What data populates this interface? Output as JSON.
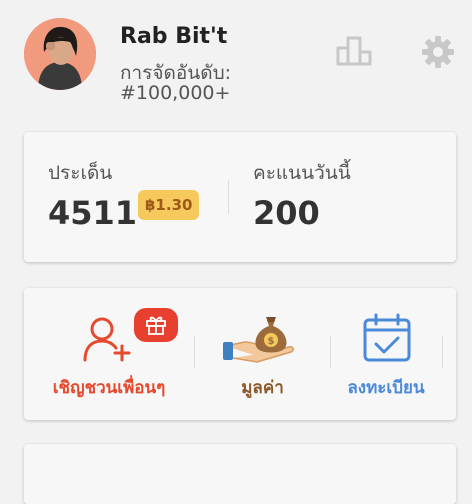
{
  "profile": {
    "name": "Rab Bit't",
    "rank_label": "การจัดอันดับ:",
    "rank_value": "#100,000+"
  },
  "points": {
    "points_label": "ประเด็น",
    "points_value": "4511",
    "baht_badge": "฿1.30",
    "today_label": "คะแนนวันนี้",
    "today_value": "200"
  },
  "actions": {
    "invite_label": "เชิญชวนเพื่อนๆ",
    "value_label": "มูลค่า",
    "register_label": "ลงทะเบียน"
  },
  "colors": {
    "invite": "#e64a2e",
    "value": "#8b5a2b",
    "register": "#4a8ad8",
    "badge_bg": "#f5c95c",
    "badge_text": "#a05a18",
    "gift_bg": "#e8402e"
  },
  "icons": {
    "leaderboard": "leaderboard-icon",
    "settings": "gear-icon",
    "invite": "add-user-icon",
    "gift": "gift-icon",
    "value": "money-bag-icon",
    "register": "calendar-check-icon"
  }
}
